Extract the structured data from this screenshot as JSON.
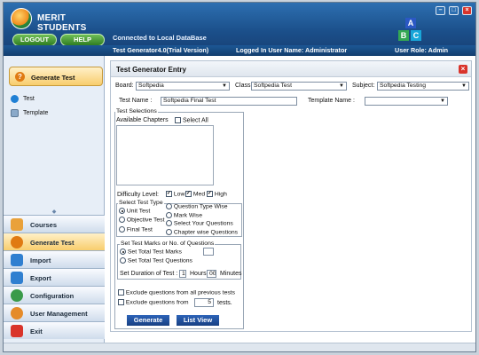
{
  "app": {
    "name": "MERIT STUDENTS",
    "connected": "Connected to Local DataBase",
    "version": "Test Generator4.0(Trial Version)",
    "user": "Logged In User Name: Administrator",
    "role": "User Role: Admin"
  },
  "header_buttons": {
    "logout": "LOGOUT",
    "help": "HELP"
  },
  "sidebar": {
    "section_title": "Generate Test",
    "items": [
      {
        "label": "Test",
        "icon": "help-circle-icon"
      },
      {
        "label": "Template",
        "icon": "template-icon"
      }
    ],
    "nav": [
      {
        "label": "Courses",
        "icon": "courses-icon",
        "active": false
      },
      {
        "label": "Generate Test",
        "icon": "help-circle-icon",
        "active": true
      },
      {
        "label": "Import",
        "icon": "import-icon",
        "active": false
      },
      {
        "label": "Export",
        "icon": "export-icon",
        "active": false
      },
      {
        "label": "Configuration",
        "icon": "configuration-icon",
        "active": false
      },
      {
        "label": "User Management",
        "icon": "users-icon",
        "active": false
      },
      {
        "label": "Exit",
        "icon": "exit-icon",
        "active": false
      }
    ]
  },
  "form": {
    "title": "Test Generator Entry",
    "board_label": "Board:",
    "board_value": "Softpedia",
    "class_label": "Class:",
    "class_value": "Softpedia Test",
    "subject_label": "Subject:",
    "subject_value": "Softpedia Testing",
    "test_name_label": "Test Name :",
    "test_name_value": "Softpedia Final Test",
    "template_name_label": "Template Name :",
    "template_name_value": "",
    "test_selections_caption": "Test Selections",
    "available_chapters_label": "Available Chapters",
    "select_all_label": "Select All",
    "difficulty_label": "Difficulty Level:",
    "difficulty": [
      {
        "label": "Low",
        "checked": true
      },
      {
        "label": "Med",
        "checked": true
      },
      {
        "label": "High",
        "checked": true
      }
    ],
    "test_type_caption": "Select Test Type",
    "test_types": [
      {
        "label": "Unit Test",
        "checked": true
      },
      {
        "label": "Objective Test",
        "checked": false
      },
      {
        "label": "Final Test",
        "checked": false
      }
    ],
    "question_modes": [
      {
        "label": "Question Type Wise",
        "checked": false
      },
      {
        "label": "Mark Wise",
        "checked": false
      },
      {
        "label": "Select Your Questions",
        "checked": false
      },
      {
        "label": "Chapter  wise Questions",
        "checked": false
      }
    ],
    "marks_caption": "Set Test Marks  or  No. of Questions",
    "set_total_marks": "Set Total Test Marks",
    "set_total_questions": "Set Total Test Questions",
    "duration_label": "Set Duration of Test :",
    "duration_hours": "1",
    "hours_label": "Hours",
    "duration_minutes": "00",
    "minutes_label": "Minutes",
    "exclude_all_label": "Exclude questions from all previous tests",
    "exclude_from_label": "Exclude questions from",
    "exclude_count": "5",
    "exclude_tests_label": "tests.",
    "generate_label": "Generate",
    "list_view_label": "List View"
  },
  "colors": {
    "header": "#1b4f8a",
    "accent_orange": "#f8cd6d",
    "button_blue": "#173f83",
    "close_red": "#d9342b"
  }
}
